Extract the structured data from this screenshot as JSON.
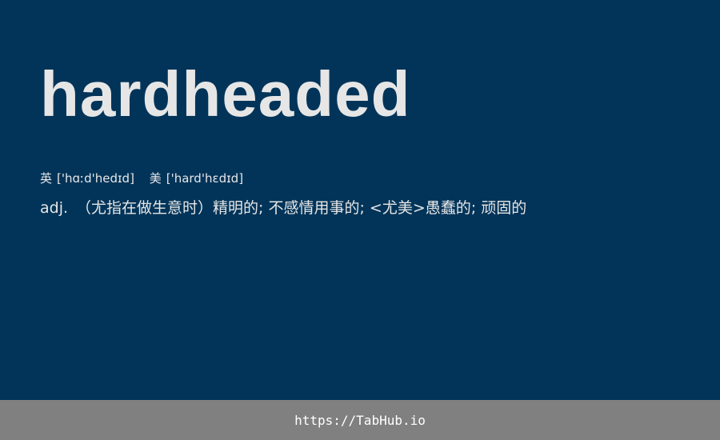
{
  "word": "hardheaded",
  "phonetics": {
    "uk": {
      "label": "英",
      "ipa": "['hɑːd'hedɪd]"
    },
    "us": {
      "label": "美",
      "ipa": "['hard'hɛdɪd]"
    }
  },
  "definition": {
    "pos": "adj.",
    "text": "（尤指在做生意时）精明的; 不感情用事的; <尤美>愚蠢的; 顽固的"
  },
  "footer": {
    "link": "https://TabHub.io"
  },
  "colors": {
    "background": "#023459",
    "text": "#e6e6e6",
    "footer_bg": "#808080",
    "footer_text": "#ffffff"
  }
}
